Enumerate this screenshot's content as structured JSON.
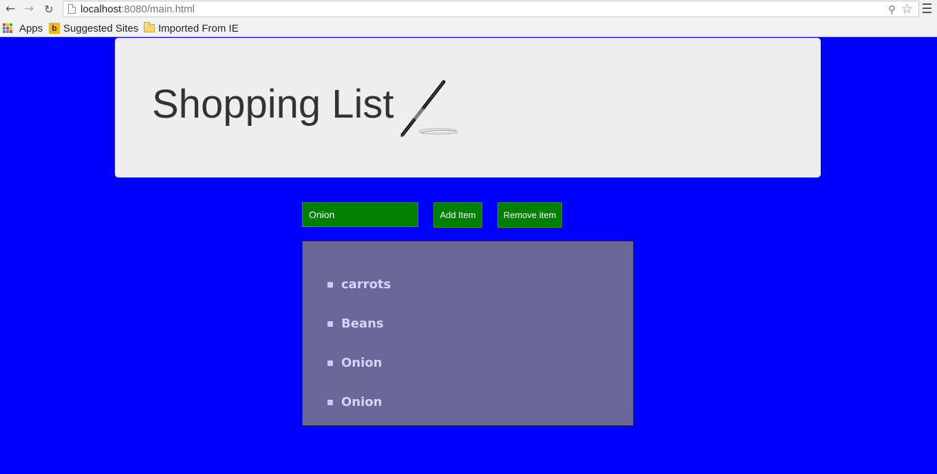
{
  "browser": {
    "url_host": "localhost",
    "url_rest": ":8080/main.html",
    "bookmarks": [
      {
        "label": "Apps",
        "icon": "apps-grid-icon"
      },
      {
        "label": "Suggested Sites",
        "icon": "bing-icon"
      },
      {
        "label": "Imported From IE",
        "icon": "folder-icon"
      }
    ]
  },
  "page": {
    "title": "Shopping List",
    "input_value": "Onion",
    "add_label": "Add Item",
    "remove_label": "Remove item",
    "items": [
      "carrots",
      "Beans",
      "Onion",
      "Onion"
    ]
  },
  "colors": {
    "background": "#0000ff",
    "jumbotron": "#eeeeee",
    "button_green": "#008000",
    "list_panel": "#686899"
  }
}
